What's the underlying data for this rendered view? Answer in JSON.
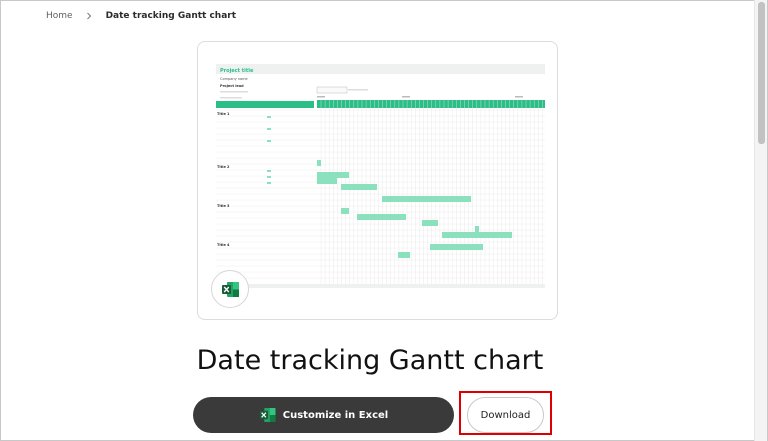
{
  "breadcrumb": {
    "home": "Home",
    "current": "Date tracking Gantt chart"
  },
  "preview": {
    "sheet_title": "Project title",
    "company": "Company name",
    "project_lead": "Project lead",
    "phases": [
      "Title 1",
      "Title 2",
      "Title 3",
      "Title 4"
    ],
    "app_icon": "excel-icon",
    "accent_color": "#2bbf87"
  },
  "title": "Date tracking Gantt chart",
  "actions": {
    "customize_label": "Customize in Excel",
    "download_label": "Download"
  },
  "colors": {
    "customize_bg": "#3a3a3a",
    "highlight": "#dd0000"
  }
}
